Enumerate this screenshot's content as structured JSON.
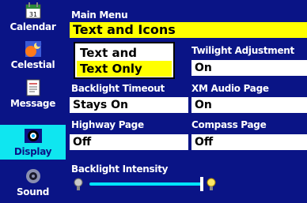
{
  "sidebar": {
    "items": [
      {
        "label": "Calendar",
        "icon": "calendar-icon"
      },
      {
        "label": "Celestial",
        "icon": "celestial-icon"
      },
      {
        "label": "Message",
        "icon": "message-icon"
      },
      {
        "label": "Display",
        "icon": "display-icon",
        "active": true
      },
      {
        "label": "Sound",
        "icon": "sound-icon"
      }
    ]
  },
  "main": {
    "menu_label": "Main Menu",
    "menu_value": "Text and Icons",
    "dropdown_options": [
      "Text and Icons",
      "Text Only"
    ],
    "dropdown_selected": "Text Only",
    "twilight_label": "Twilight Adjustment",
    "twilight_value": "On",
    "backlight_timeout_label": "Backlight Timeout",
    "backlight_timeout_value": "Stays On",
    "xm_audio_label": "XM Audio Page",
    "xm_audio_value": "On",
    "highway_label": "Highway Page",
    "highway_value": "Off",
    "compass_label": "Compass Page",
    "compass_value": "Off",
    "intensity_label": "Backlight Intensity",
    "intensity_level": 1.0
  },
  "colors": {
    "background": "#0a1486",
    "highlight": "#ffff00",
    "active_tab": "#0fe6f0",
    "slider": "#00e4ff"
  }
}
